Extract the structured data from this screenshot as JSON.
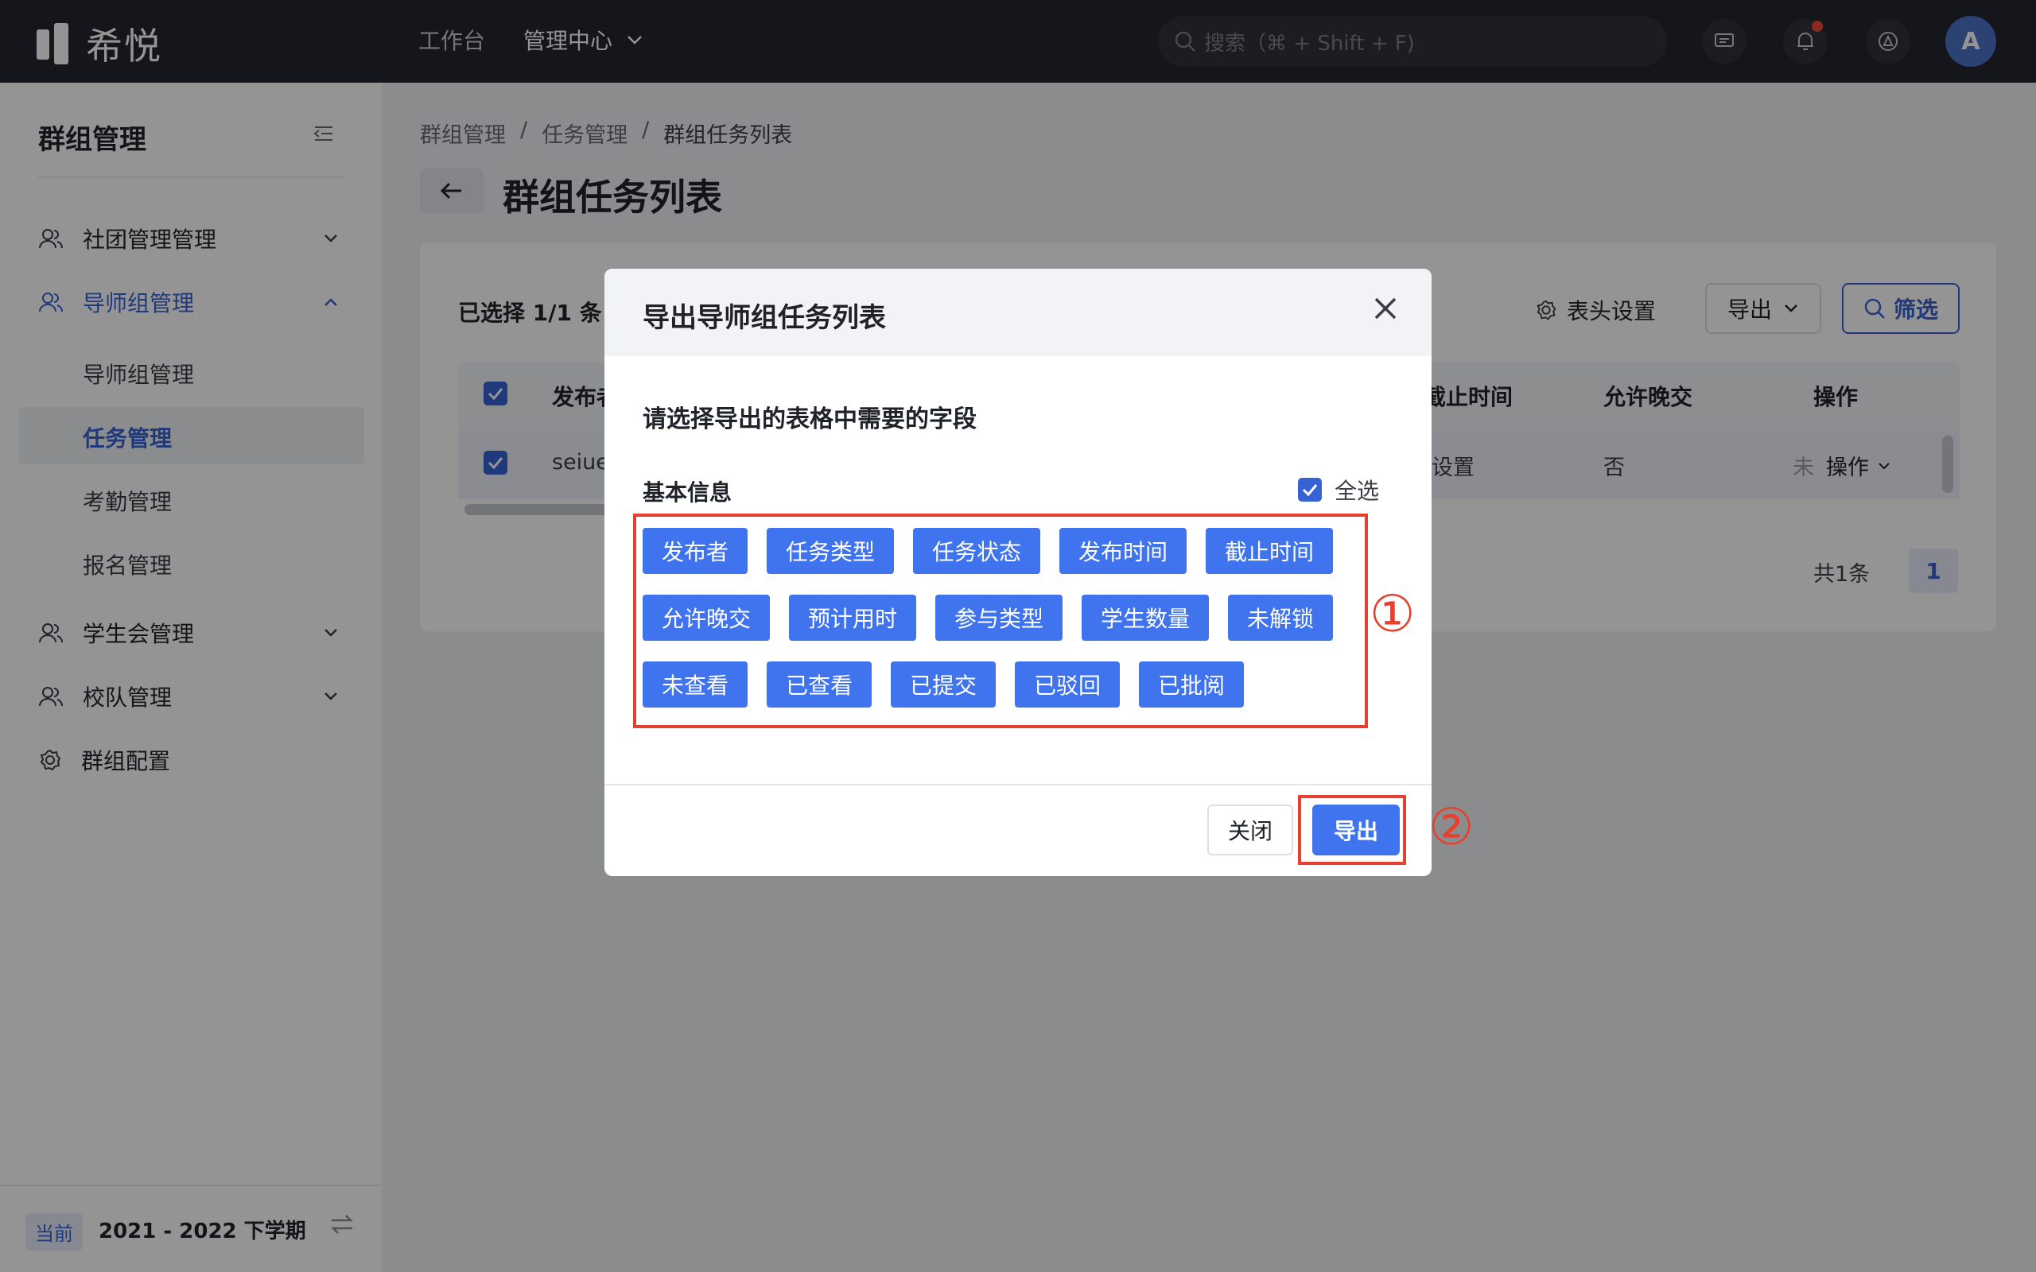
{
  "app": {
    "logo_text": "希悦"
  },
  "topnav": {
    "workbench": "工作台",
    "mgmt_center": "管理中心",
    "search_placeholder": "搜索（⌘ + Shift + F)",
    "avatar": "A"
  },
  "sidebar": {
    "title": "群组管理",
    "items": [
      {
        "label": "社团管理管理"
      },
      {
        "label": "导师组管理"
      },
      {
        "label": "学生会管理"
      },
      {
        "label": "校队管理"
      },
      {
        "label": "群组配置"
      }
    ],
    "sub_items": [
      {
        "label": "导师组管理"
      },
      {
        "label": "任务管理"
      },
      {
        "label": "考勤管理"
      },
      {
        "label": "报名管理"
      }
    ],
    "footer": {
      "current_badge": "当前",
      "term": "2021 - 2022 下学期"
    }
  },
  "breadcrumb": {
    "b1": "群组管理",
    "sep": "/",
    "b2": "任务管理",
    "b3": "群组任务列表"
  },
  "page": {
    "title": "群组任务列表"
  },
  "toolbar": {
    "selected": "已选择 1/1 条，",
    "header_settings": "表头设置",
    "export": "导出",
    "filter": "筛选"
  },
  "table": {
    "col_publisher": "发布者",
    "col_deadline": "截止时间",
    "col_late": "允许晚交",
    "col_action": "操作",
    "row": {
      "publisher": "seiue",
      "deadline": "设置",
      "late": "否",
      "action": "操作",
      "truncated": "未"
    }
  },
  "pagination": {
    "total": "共1条",
    "page": "1"
  },
  "modal": {
    "title": "导出导师组任务列表",
    "desc": "请选择导出的表格中需要的字段",
    "group": "基本信息",
    "select_all": "全选",
    "tags": [
      "发布者",
      "任务类型",
      "任务状态",
      "发布时间",
      "截止时间",
      "允许晚交",
      "预计用时",
      "参与类型",
      "学生数量",
      "未解锁",
      "未查看",
      "已查看",
      "已提交",
      "已驳回",
      "已批阅"
    ],
    "close": "关闭",
    "export": "导出"
  },
  "annotations": {
    "one": "①",
    "two": "②"
  },
  "colors": {
    "accent": "#3762d4",
    "tag": "#3f74ee",
    "highlight": "#e8402e",
    "topbar": "#25272f"
  }
}
